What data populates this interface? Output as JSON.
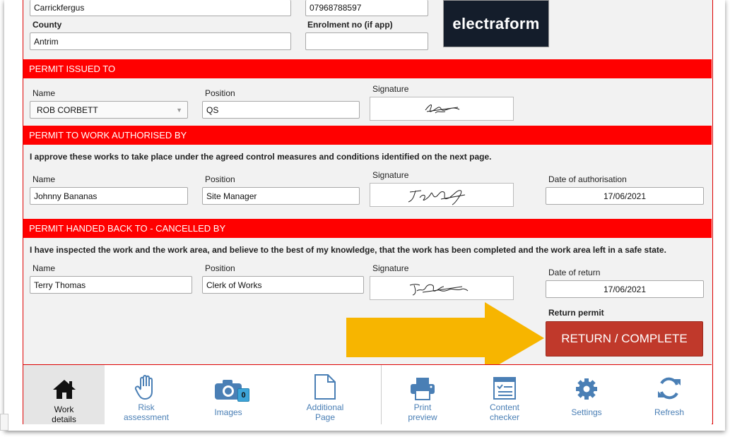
{
  "top": {
    "town_value": "Carrickfergus",
    "phone_value": "07968788597",
    "county_label": "County",
    "county_value": "Antrim",
    "enrolment_label": "Enrolment no (if app)",
    "enrolment_value": "",
    "logo_text": "electraform"
  },
  "issued": {
    "header": "PERMIT ISSUED TO",
    "name_label": "Name",
    "name_value": "ROB CORBETT",
    "position_label": "Position",
    "position_value": "QS",
    "signature_label": "Signature"
  },
  "authorised": {
    "header": "PERMIT TO WORK AUTHORISED BY",
    "note": "I approve these works to take place under the agreed control measures and conditions identified on the next page.",
    "name_label": "Name",
    "name_value": "Johnny Bananas",
    "position_label": "Position",
    "position_value": "Site Manager",
    "signature_label": "Signature",
    "date_label": "Date of authorisation",
    "date_value": "17/06/2021"
  },
  "handed_back": {
    "header": "PERMIT HANDED BACK TO - CANCELLED BY",
    "note": "I have inspected the work and the work area, and believe to the best of my knowledge, that the work has been completed and the work area left in a safe state.",
    "name_label": "Name",
    "name_value": "Terry Thomas",
    "position_label": "Position",
    "position_value": "Clerk of Works",
    "signature_label": "Signature",
    "date_label": "Date of return",
    "date_value": "17/06/2021",
    "return_label": "Return permit",
    "return_button": "RETURN / COMPLETE"
  },
  "tabs": [
    {
      "label1": "Work",
      "label2": "details",
      "icon": "home-icon"
    },
    {
      "label1": "Risk",
      "label2": "assessment",
      "icon": "hand-icon"
    },
    {
      "label1": "Images",
      "label2": "",
      "icon": "camera-icon",
      "badge": "0"
    },
    {
      "label1": "Additional",
      "label2": "Page",
      "icon": "page-icon"
    },
    {
      "label1": "Print",
      "label2": "preview",
      "icon": "printer-icon"
    },
    {
      "label1": "Content",
      "label2": "checker",
      "icon": "checklist-icon"
    },
    {
      "label1": "Settings",
      "label2": "",
      "icon": "gear-icon"
    },
    {
      "label1": "Refresh",
      "label2": "",
      "icon": "refresh-icon"
    }
  ],
  "colors": {
    "header_red": "#ff0000",
    "button_red": "#c0392b",
    "arrow_yellow": "#f7b500",
    "tab_blue": "#4a7fb5"
  }
}
